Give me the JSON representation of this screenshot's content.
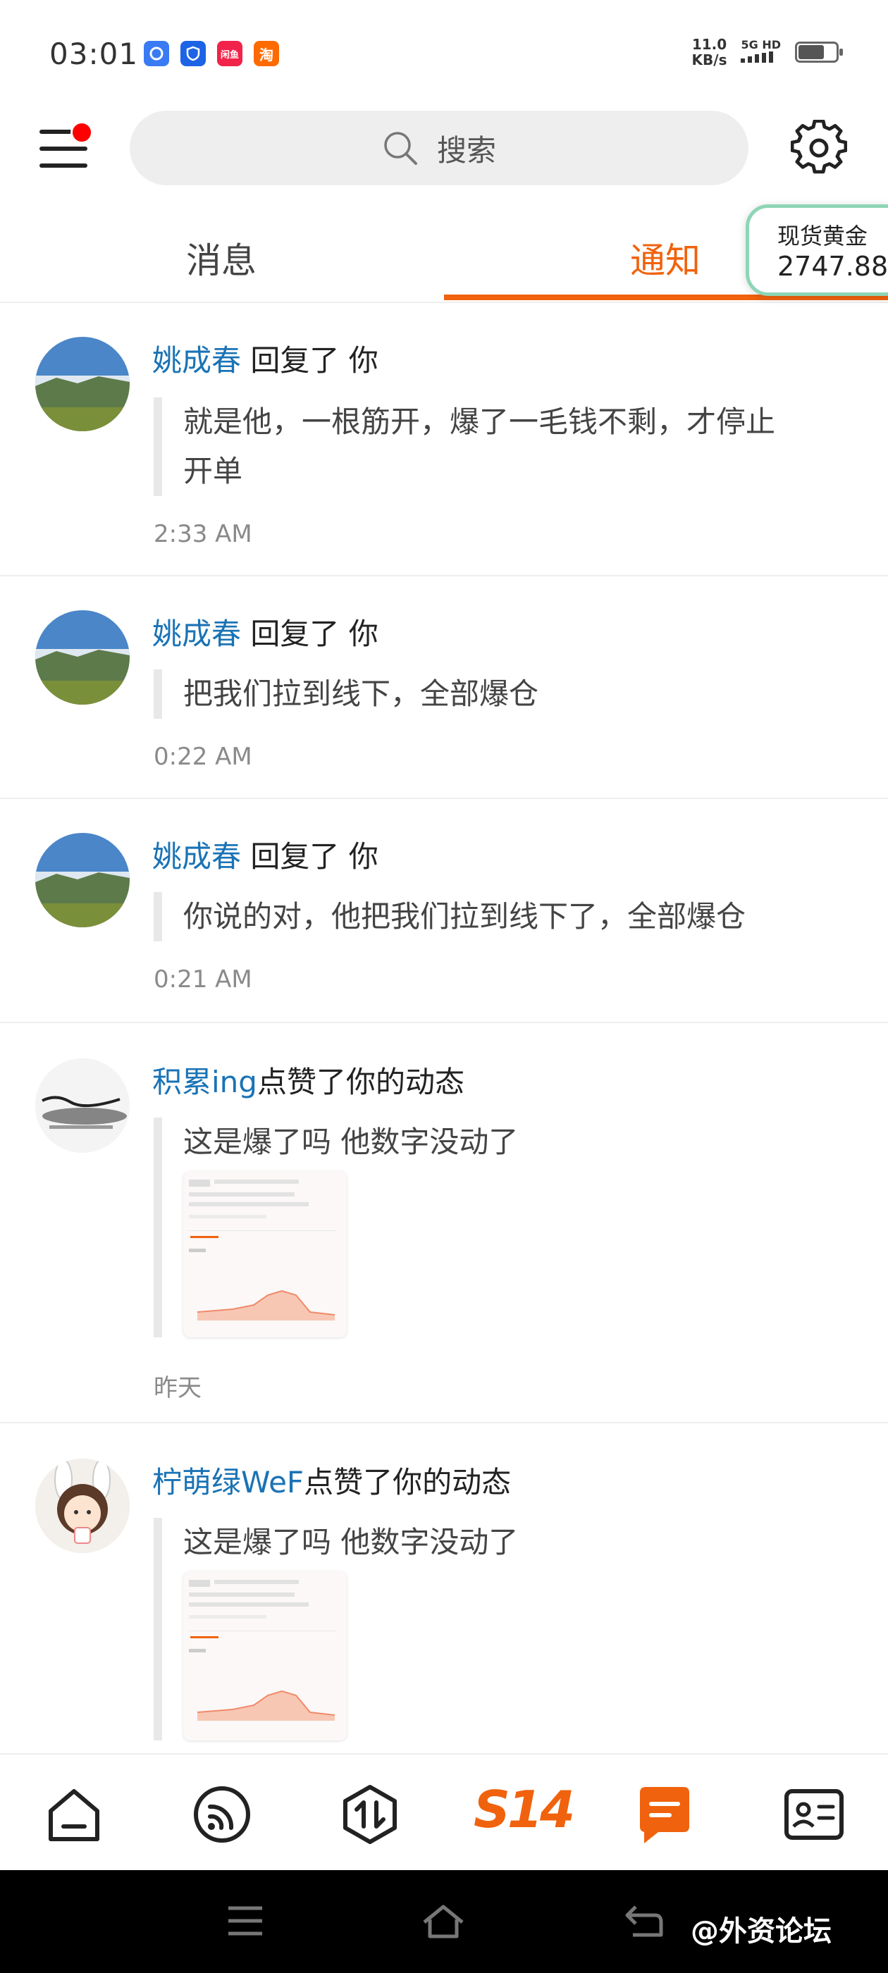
{
  "status_bar": {
    "time": "03:01",
    "apps": [
      "app-icon-1",
      "shield-app-icon",
      "xianyu-app-icon",
      "taobao-app-icon"
    ],
    "app_labels": [
      "",
      "",
      "闲鱼",
      "淘"
    ],
    "speed_value": "11.0",
    "speed_unit": "KB/s",
    "network": "5G HD",
    "battery_level": 0.6
  },
  "header": {
    "search_placeholder": "搜索"
  },
  "tabs": [
    {
      "label": "消息",
      "active": false
    },
    {
      "label": "通知",
      "active": true
    }
  ],
  "gold_widget": {
    "label": "现货黄金",
    "value": "2747.88"
  },
  "notifications": [
    {
      "name": "姚成春",
      "action": "回复了 你",
      "text_line1": "就是他，一根筋开，爆了一毛钱不剩，才停止",
      "text_line2": "开单",
      "time": "2:33 AM"
    },
    {
      "name": "姚成春",
      "action": "回复了 你",
      "text_line1": "把我们拉到线下，全部爆仓",
      "time": "0:22 AM"
    },
    {
      "name": "姚成春",
      "action": "回复了 你",
      "text_line1": "你说的对，他把我们拉到线下了，全部爆仓",
      "time": "0:21 AM"
    },
    {
      "name": "积累ing",
      "action": "点赞了你的动态",
      "text_line1": "这是爆了吗 他数字没动了",
      "time": "昨天"
    },
    {
      "name": "柠萌绿WeF",
      "action": "点赞了你的动态",
      "text_line1": "这是爆了吗 他数字没动了"
    }
  ],
  "bottom_nav": {
    "items": [
      "home-icon",
      "feed-icon",
      "trade-icon",
      "s14-logo",
      "message-icon",
      "profile-card-icon"
    ],
    "s14_label": "S14"
  },
  "watermark": "@外资论坛",
  "colors": {
    "accent": "#f0620d",
    "name_blue": "#1a73b5",
    "gold_border": "#8ed5b6"
  }
}
